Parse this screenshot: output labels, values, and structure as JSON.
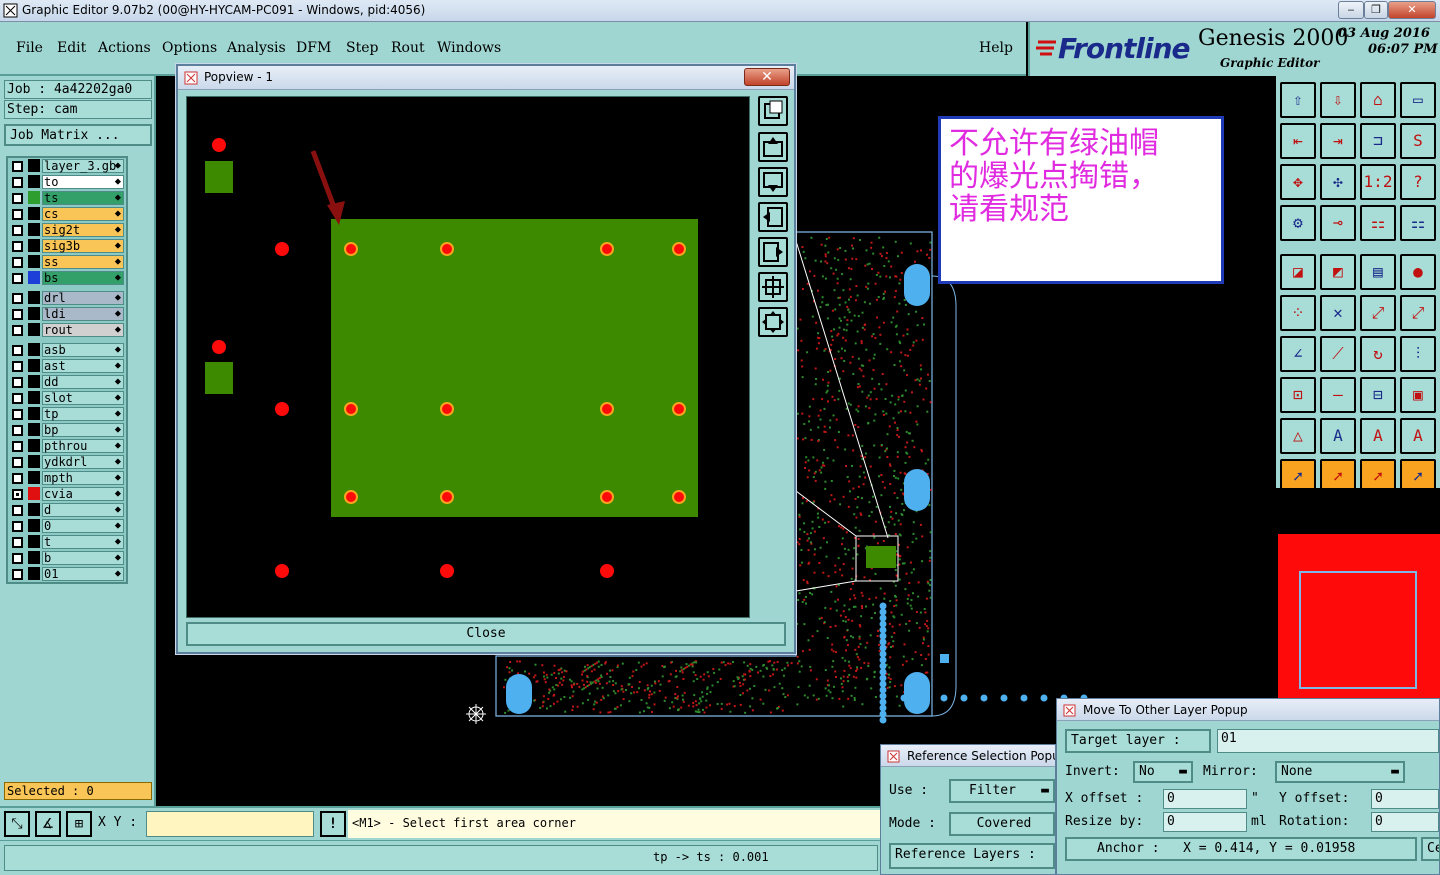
{
  "window": {
    "title": "Graphic Editor 9.07b2 (00@HY-HYCAM-PC091 - Windows, pid:4056)"
  },
  "menu": {
    "items": [
      "File",
      "Edit",
      "Actions",
      "Options",
      "Analysis",
      "DFM",
      "Step",
      "Rout",
      "Windows"
    ],
    "help": "Help"
  },
  "brand": {
    "logo": "Frontline",
    "product": "Genesis 2000",
    "subtitle": "Graphic Editor",
    "date": "03 Aug 2016",
    "time": "06:07 PM"
  },
  "job": {
    "label": "Job : 4a42202ga0",
    "step": "Step: cam",
    "matrix_button": "Job Matrix ..."
  },
  "layers": [
    {
      "name": "layer_3.gb",
      "color": "#000000",
      "bg": "#a8dcd7"
    },
    {
      "name": "to",
      "color": "#000000",
      "bg": "#ffffff"
    },
    {
      "name": "ts",
      "color": "#2e9e2e",
      "bg": "#33a06a",
      "active": true
    },
    {
      "name": "cs",
      "color": "#000000",
      "bg": "#f9c556"
    },
    {
      "name": "sig2t",
      "color": "#000000",
      "bg": "#f9c556"
    },
    {
      "name": "sig3b",
      "color": "#000000",
      "bg": "#f9c556"
    },
    {
      "name": "ss",
      "color": "#000000",
      "bg": "#f9c556"
    },
    {
      "name": "bs",
      "color": "#1e3fd8",
      "bg": "#33a06a",
      "active": true
    },
    {
      "name": "drl",
      "color": "#000000",
      "bg": "#a9b9c9",
      "gap": true
    },
    {
      "name": "ldi",
      "color": "#000000",
      "bg": "#a9b9c9"
    },
    {
      "name": "rout",
      "color": "#000000",
      "bg": "#d0d0d0"
    },
    {
      "name": "asb",
      "color": "#000000",
      "bg": "#a8dcd7",
      "gap": true
    },
    {
      "name": "ast",
      "color": "#000000",
      "bg": "#a8dcd7"
    },
    {
      "name": "dd",
      "color": "#000000",
      "bg": "#a8dcd7"
    },
    {
      "name": "slot",
      "color": "#000000",
      "bg": "#a8dcd7"
    },
    {
      "name": "tp",
      "color": "#000000",
      "bg": "#a8dcd7"
    },
    {
      "name": "bp",
      "color": "#000000",
      "bg": "#a8dcd7"
    },
    {
      "name": "pthrou",
      "color": "#000000",
      "bg": "#a8dcd7"
    },
    {
      "name": "ydkdrl",
      "color": "#000000",
      "bg": "#a8dcd7"
    },
    {
      "name": "mpth",
      "color": "#000000",
      "bg": "#a8dcd7"
    },
    {
      "name": "cvia",
      "color": "#e01010",
      "bg": "#a8dcd7",
      "active": true
    },
    {
      "name": "d",
      "color": "#000000",
      "bg": "#a8dcd7"
    },
    {
      "name": "0",
      "color": "#000000",
      "bg": "#a8dcd7"
    },
    {
      "name": "t",
      "color": "#000000",
      "bg": "#a8dcd7"
    },
    {
      "name": "b",
      "color": "#000000",
      "bg": "#a8dcd7"
    },
    {
      "name": "01",
      "color": "#000000",
      "bg": "#a8dcd7"
    }
  ],
  "selected": "Selected : 0",
  "popview": {
    "title": "Popview - 1",
    "close": "Close"
  },
  "note": {
    "lines": [
      "不允许有绿油帽",
      "的爆光点掏错，",
      "请看规范"
    ]
  },
  "status": {
    "xy_label": "X Y :",
    "xy_value": "",
    "warn": "!",
    "prompt": "<M1> - Select first area corner",
    "measure": "tp -> ts : 0.001"
  },
  "refsel": {
    "title": "Reference Selection Popup",
    "use_label": "Use  :",
    "use_value": "Filter",
    "mode_label": "Mode :",
    "mode_value": "Covered",
    "ref_layers": "Reference Layers :"
  },
  "movepop": {
    "title": "Move To Other Layer Popup",
    "target_label": "Target layer :",
    "target_value": "01",
    "invert_label": "Invert:",
    "invert_value": "No",
    "mirror_label": "Mirror:",
    "mirror_value": "None",
    "xoff_label": "X offset :",
    "xoff_value": "0",
    "xoff_unit": "\"",
    "yoff_label": "Y offset:",
    "yoff_value": "0",
    "resize_label": "Resize by:",
    "resize_value": "0",
    "resize_unit": "ml",
    "rot_label": "Rotation:",
    "rot_value": "0",
    "anchor": "Anchor :   X = 0.414, Y = 0.01958",
    "cen": "Ce"
  },
  "colors": {
    "panel": "#9fd6d1",
    "field": "#a8dcd7",
    "copper": "#3d8a00",
    "pad": "#ff0a0a",
    "orange": "#f9a320",
    "board": "#7fb8e8"
  }
}
